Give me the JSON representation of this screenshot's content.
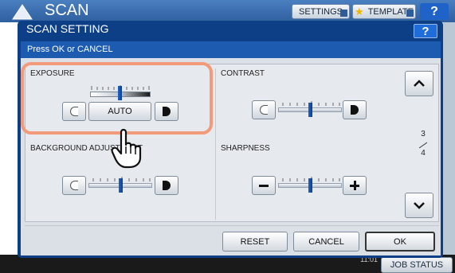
{
  "app": {
    "title": "SCAN",
    "settings_label": "SETTINGS",
    "template_label": "TEMPLATE",
    "help_label": "?",
    "time": "11:01",
    "job_status_label": "JOB STATUS"
  },
  "dialog": {
    "title": "SCAN SETTING",
    "help_label": "?",
    "message": "Press OK or CANCEL"
  },
  "sections": {
    "exposure": {
      "label": "EXPOSURE",
      "auto_label": "AUTO",
      "level": 5,
      "steps": 11
    },
    "contrast": {
      "label": "CONTRAST",
      "level": 5,
      "steps": 9
    },
    "background": {
      "label": "BACKGROUND ADJUSTMENT",
      "level": 5,
      "steps": 9
    },
    "sharpness": {
      "label": "SHARPNESS",
      "level": 5,
      "steps": 9
    }
  },
  "pager": {
    "current": "3",
    "total": "4"
  },
  "actions": {
    "reset": "RESET",
    "cancel": "CANCEL",
    "ok": "OK"
  },
  "colors": {
    "accent": "#1f63c9",
    "dialog_bg": "#0d3f87",
    "highlight": "#f39a7a"
  }
}
